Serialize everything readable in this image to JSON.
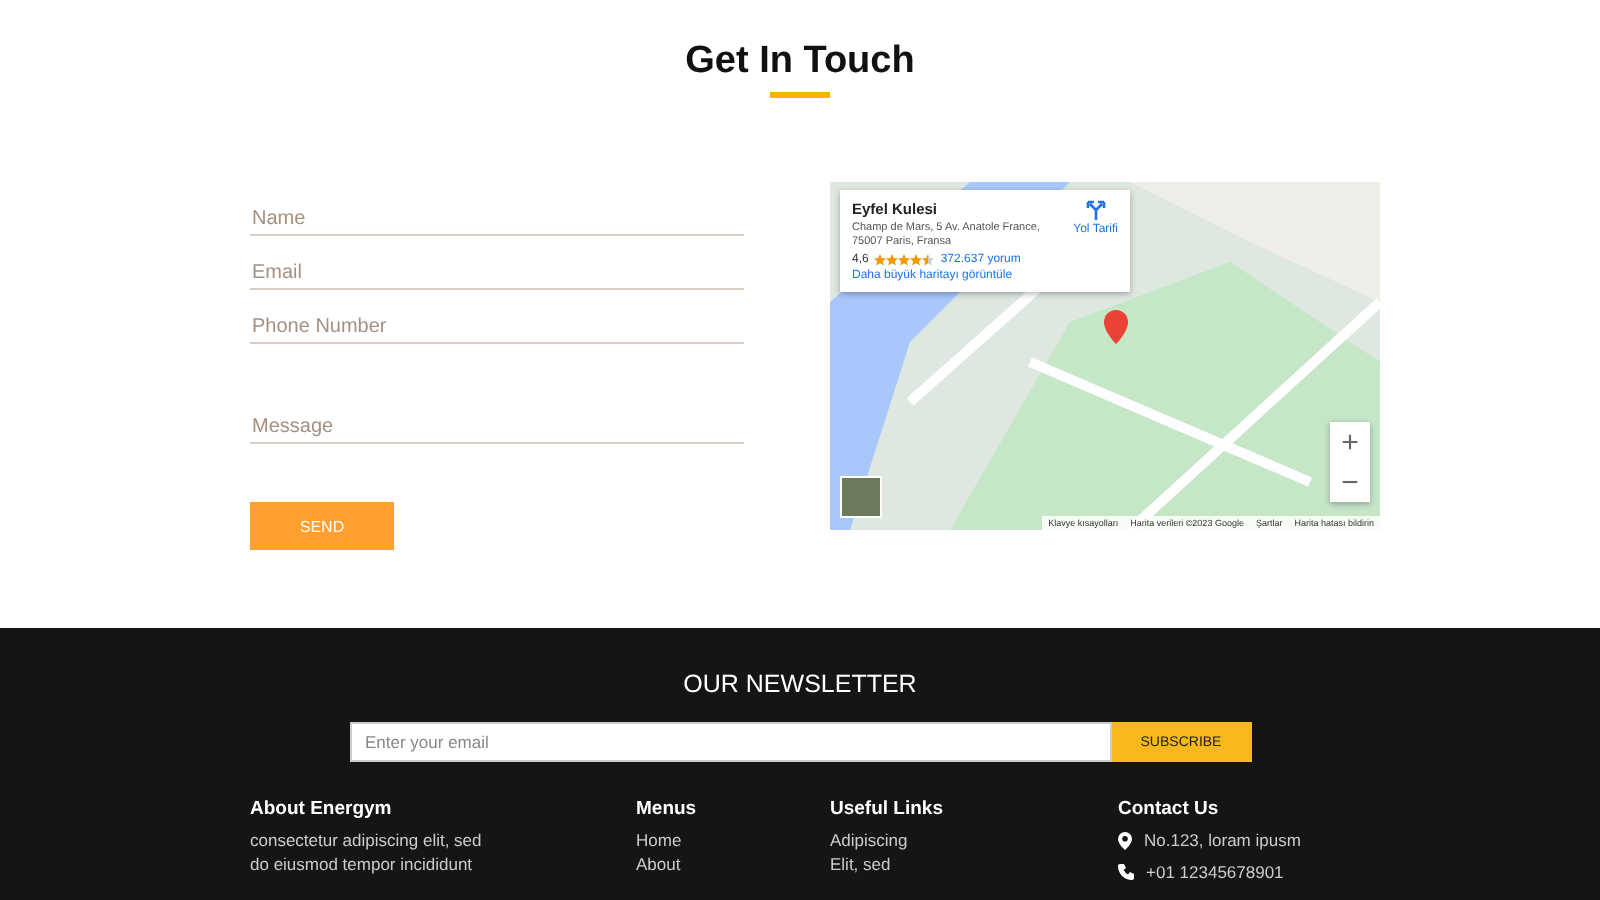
{
  "contact": {
    "title": "Get In Touch",
    "fields": [
      {
        "placeholder": "Name",
        "kind": "line"
      },
      {
        "placeholder": "Email",
        "kind": "line"
      },
      {
        "placeholder": "Phone Number",
        "kind": "line"
      },
      {
        "placeholder": "Message",
        "kind": "area"
      }
    ],
    "send_button": "SEND"
  },
  "map": {
    "place_name": "Eyfel Kulesi",
    "address": "Champ de Mars, 5 Av. Anatole France, 75007 Paris, Fransa",
    "directions": "Yol Tarifi",
    "rating": "4,6",
    "stars": 4.5,
    "reviews": "372.637 yorum",
    "larger_map_link": "Daha büyük haritayı görüntüle",
    "zoom_in": "+",
    "zoom_out": "−",
    "attribution": [
      "Klavye kısayolları",
      "Harita verileri ©2023 Google",
      "Şartlar",
      "Harita hatası bildirin"
    ]
  },
  "newsletter": {
    "title": "OUR NEWSLETTER",
    "placeholder": "Enter your email",
    "button": "SUBSCRIBE"
  },
  "footer": {
    "columns": [
      {
        "kind": "text",
        "title": "About Energym",
        "lines": [
          "consectetur adipiscing elit, sed",
          "do eiusmod tempor incididunt"
        ]
      },
      {
        "kind": "links",
        "title": "Menus",
        "lines": [
          "Home",
          "About"
        ]
      },
      {
        "kind": "links",
        "title": "Useful Links",
        "lines": [
          "Adipiscing",
          "Elit, sed"
        ]
      },
      {
        "kind": "contact",
        "title": "Contact Us",
        "lines": [
          "No.123, loram ipusm",
          "+01 12345678901"
        ]
      }
    ]
  }
}
